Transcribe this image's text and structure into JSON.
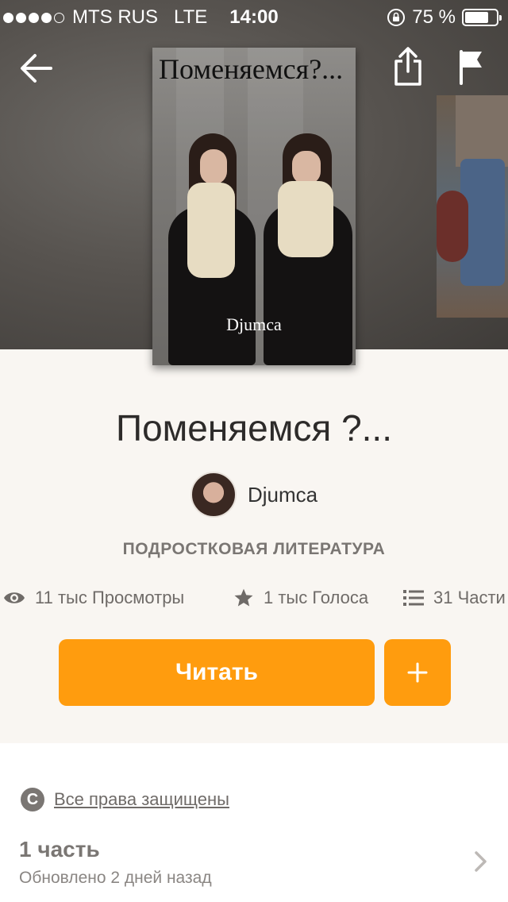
{
  "status_bar": {
    "carrier": "MTS RUS",
    "network": "LTE",
    "time": "14:00",
    "battery_level": "75 %",
    "battery_fraction": 0.75,
    "signal_bars_filled": 4,
    "signal_bars_total": 5
  },
  "header": {
    "back_icon": "arrow-left-icon",
    "share_icon": "share-icon",
    "flag_icon": "flag-icon"
  },
  "cover": {
    "title_text": "Поменяемся?...",
    "author_text": "Djumca"
  },
  "story": {
    "title": "Поменяемся ?...",
    "author": "Djumca",
    "genre": "ПОДРОСТКОВАЯ ЛИТЕРАТУРА"
  },
  "stats": {
    "views": "11 тыс Просмотры",
    "votes": "1 тыс Голоса",
    "parts": "31 Части"
  },
  "actions": {
    "read_label": "Читать",
    "add_label": "+"
  },
  "footer": {
    "copyright_symbol": "C",
    "copyright_text": "Все права защищены",
    "part_title": "1 часть",
    "part_updated": "Обновлено 2 дней назад"
  },
  "colors": {
    "accent": "#ff9c0e",
    "muted_text": "#7a7673",
    "header_bg": "#57534f"
  }
}
